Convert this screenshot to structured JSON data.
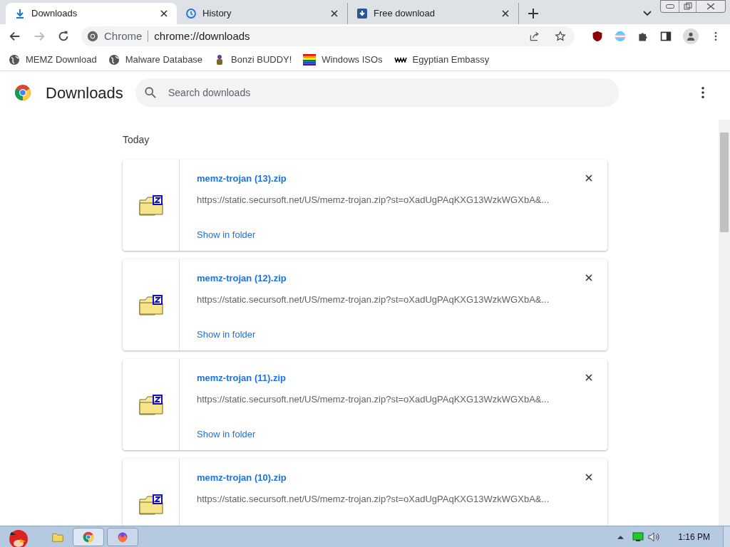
{
  "tabs": [
    {
      "title": "Downloads",
      "kind": "download",
      "selected": true
    },
    {
      "title": "History",
      "kind": "history",
      "selected": false
    },
    {
      "title": "Free download",
      "kind": "site",
      "selected": false
    }
  ],
  "address_bar": {
    "site_label": "Chrome",
    "url": "chrome://downloads"
  },
  "bookmarks": [
    {
      "label": "MEMZ Download",
      "kind": "globe"
    },
    {
      "label": "Malware Database",
      "kind": "globe"
    },
    {
      "label": "Bonzi BUDDY!",
      "kind": "figure"
    },
    {
      "label": "Windows ISOs",
      "kind": "rainbow"
    },
    {
      "label": "Egyptian Embassy",
      "kind": "wix"
    }
  ],
  "page": {
    "title": "Downloads",
    "search": {
      "placeholder": "Search downloads"
    },
    "section": "Today",
    "items": [
      {
        "name": "memz-trojan (13).zip",
        "url": "https://static.secursoft.net/US/memz-trojan.zip?st=oXadUgPAqKXG13WzkWGXbA&...",
        "action": "Show in folder"
      },
      {
        "name": "memz-trojan (12).zip",
        "url": "https://static.secursoft.net/US/memz-trojan.zip?st=oXadUgPAqKXG13WzkWGXbA&...",
        "action": "Show in folder"
      },
      {
        "name": "memz-trojan (11).zip",
        "url": "https://static.secursoft.net/US/memz-trojan.zip?st=oXadUgPAqKXG13WzkWGXbA&...",
        "action": "Show in folder"
      },
      {
        "name": "memz-trojan (10).zip",
        "url": "https://static.secursoft.net/US/memz-trojan.zip?st=oXadUgPAqKXG13WzkWGXbA&..."
      }
    ]
  },
  "taskbar": {
    "clock": "1:16 PM"
  }
}
